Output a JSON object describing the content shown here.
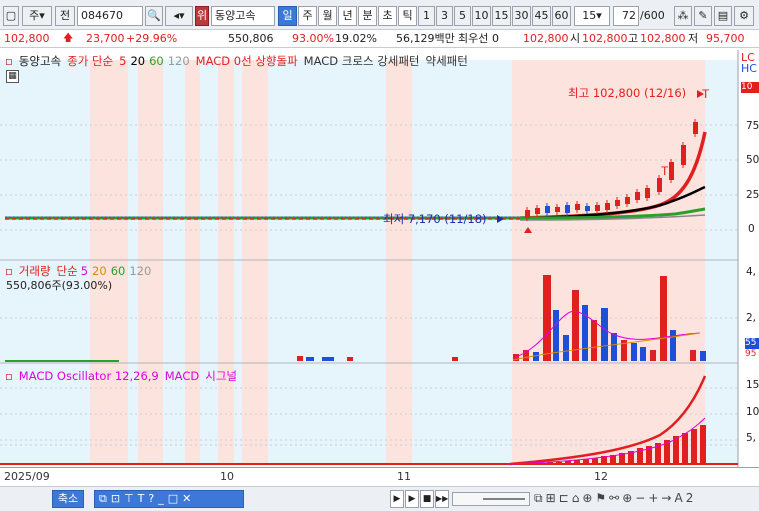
{
  "toolbar": {
    "period_main": "주",
    "prefix": "전",
    "stock_code": "084670",
    "brand_badge": "위",
    "stock_name": "동양고속",
    "periods": [
      "일",
      "주",
      "월",
      "년",
      "분",
      "초",
      "틱"
    ],
    "active_period": "일",
    "intervals": [
      "1",
      "3",
      "5",
      "10",
      "15",
      "30",
      "45",
      "60"
    ],
    "interval_select": "15",
    "range_value": "72",
    "range_total": "/600"
  },
  "quote": {
    "price": "102,800",
    "change": "23,700",
    "change_pct": "+29.96%",
    "volume": "550,806",
    "volume_ratio": "93.00%",
    "turnover": "19.02%",
    "amount": "56,129백만",
    "best_label": "최우선",
    "best_value": "0",
    "ask": "102,800",
    "open_label": "시",
    "open_value": "102,800",
    "high_label": "고",
    "high_value": "102,800",
    "low_label": "저",
    "low_value": "95,700"
  },
  "price_panel": {
    "legend": [
      "동양고속",
      "종가 단순",
      "5",
      "20",
      "60",
      "120",
      "MACD 0선 상향돌파",
      "MACD 크로스 강세패턴",
      "약세패턴"
    ],
    "high_note": "최고 102,800 (12/16)",
    "low_note": "최저 7,170 (11/18)",
    "axis_labels": [
      "75",
      "50",
      "25",
      "0"
    ],
    "right_tags": [
      "LC",
      "HC",
      "10"
    ]
  },
  "volume_panel": {
    "legend": [
      "거래량",
      "단순",
      "5",
      "20",
      "60",
      "120"
    ],
    "volume_text": "550,806주(93.00%)",
    "axis_labels": [
      "4,",
      "2,"
    ],
    "right_tags": [
      "55",
      "95"
    ]
  },
  "macd_panel": {
    "legend": [
      "MACD Oscillator 12,26,9",
      "MACD",
      "시그널"
    ],
    "axis_labels": [
      "15",
      "10",
      "5,"
    ]
  },
  "dates": [
    "2025/09",
    "10",
    "11",
    "12"
  ],
  "bottom": {
    "zoom_label": "축소"
  },
  "colors": {
    "up": "#e0201f",
    "down": "#1f4fd8",
    "ma5": "#e02020",
    "ma20": "#000000",
    "ma60": "#2aa02a",
    "ma120": "#888888",
    "macd": "#e000e0",
    "shade_pink": "#fde3de",
    "shade_blue": "#e6f4fb"
  },
  "chart_data": {
    "type": "candlestick",
    "note_high": "최고 102,800 (12/16)",
    "note_low": "최저 7,170 (11/18)",
    "price_y_ticks": [
      0,
      25,
      50,
      75
    ],
    "last_close": 102800
  }
}
